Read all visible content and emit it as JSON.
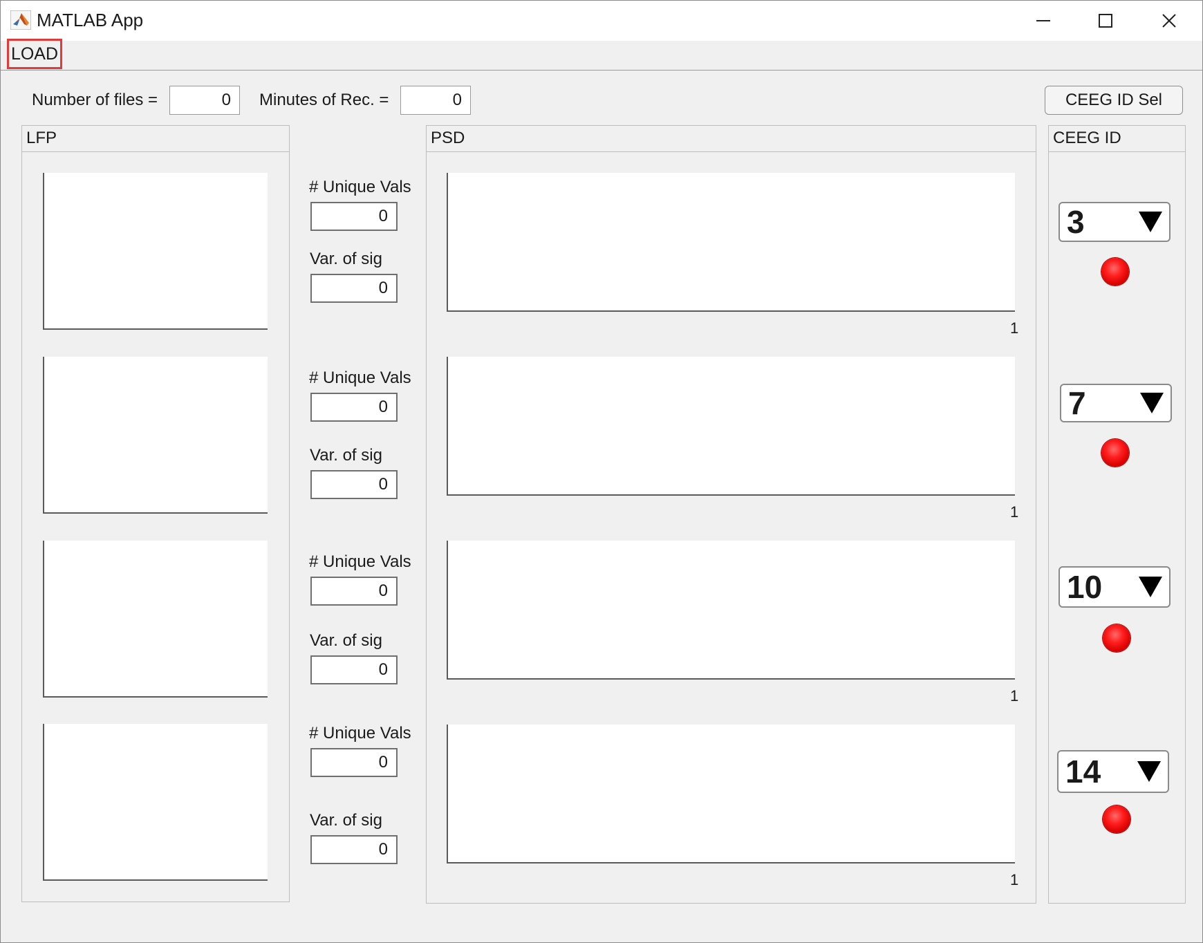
{
  "window": {
    "title": "MATLAB App"
  },
  "menubar": {
    "load_label": "LOAD"
  },
  "top": {
    "num_files_label": "Number of files =",
    "num_files_value": "0",
    "minutes_label": "Minutes of Rec. =",
    "minutes_value": "0",
    "ceeg_sel_button": "CEEG ID Sel"
  },
  "panels": {
    "lfp_title": "LFP",
    "psd_title": "PSD",
    "ceeg_title": "CEEG ID"
  },
  "channels": [
    {
      "unique_label": "# Unique Vals",
      "unique_value": "0",
      "var_label": "Var. of sig",
      "var_value": "0",
      "psd_tick": "1",
      "ceeg_id": "3",
      "lamp_color": "#ff1e1e"
    },
    {
      "unique_label": "# Unique Vals",
      "unique_value": "0",
      "var_label": "Var. of sig",
      "var_value": "0",
      "psd_tick": "1",
      "ceeg_id": "7",
      "lamp_color": "#ff1e1e"
    },
    {
      "unique_label": "# Unique Vals",
      "unique_value": "0",
      "var_label": "Var. of sig",
      "var_value": "0",
      "psd_tick": "1",
      "ceeg_id": "10",
      "lamp_color": "#ff1e1e"
    },
    {
      "unique_label": "# Unique Vals",
      "unique_value": "0",
      "var_label": "Var. of sig",
      "var_value": "0",
      "psd_tick": "1",
      "ceeg_id": "14",
      "lamp_color": "#ff1e1e"
    }
  ],
  "icons": {
    "app": "matlab-logo-icon",
    "minimize": "minimize-icon",
    "maximize": "maximize-icon",
    "close": "close-icon",
    "dropdown": "triangle-down-icon"
  }
}
